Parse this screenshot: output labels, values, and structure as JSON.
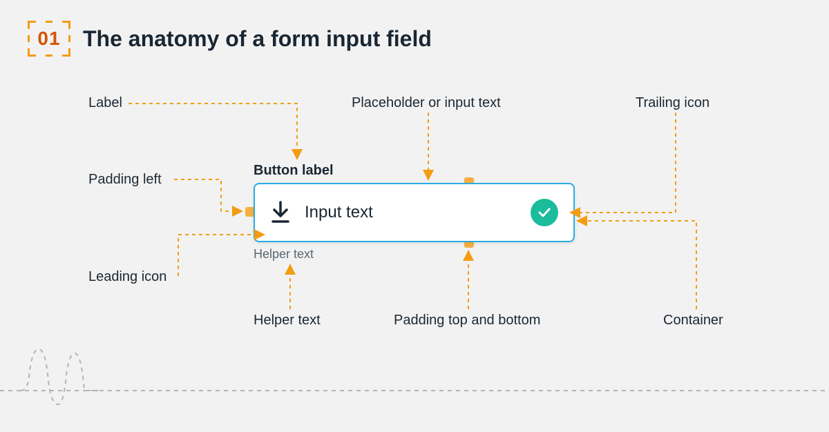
{
  "header": {
    "number": "01",
    "title": "The anatomy of a form input field"
  },
  "input": {
    "button_label": "Button label",
    "placeholder_text": "Input text",
    "helper_text": "Helper text"
  },
  "callouts": {
    "label": "Label",
    "placeholder": "Placeholder or input text",
    "trailing_icon": "Trailing icon",
    "padding_left": "Padding left",
    "leading_icon": "Leading icon",
    "helper_text": "Helper text",
    "padding_tb": "Padding top and bottom",
    "container": "Container"
  },
  "colors": {
    "accent_orange": "#f39c12",
    "dark_orange": "#d35400",
    "input_border": "#29abe2",
    "check_bg": "#1abc9c",
    "text_dark": "#1a2733"
  }
}
